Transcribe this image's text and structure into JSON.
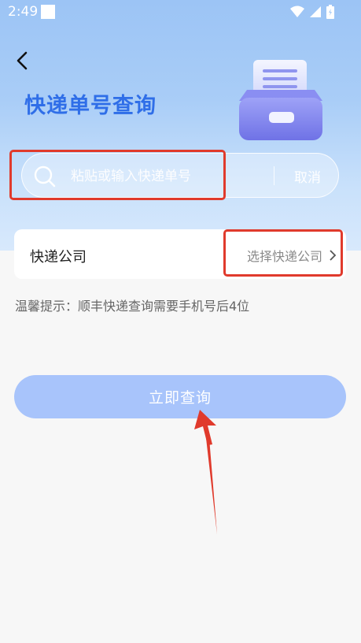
{
  "status_bar": {
    "time": "2:49"
  },
  "header": {
    "title": "快递单号查询"
  },
  "search": {
    "placeholder": "粘贴或输入快递单号",
    "cancel_label": "取消"
  },
  "company_row": {
    "label": "快递公司",
    "select_label": "选择快递公司"
  },
  "tip": {
    "text": "温馨提示：顺丰快递查询需要手机号后4位"
  },
  "query_button": {
    "label": "立即查询"
  },
  "colors": {
    "accent": "#2f6ee8",
    "button": "#a8c4fb",
    "annotation": "#e03a2c"
  }
}
